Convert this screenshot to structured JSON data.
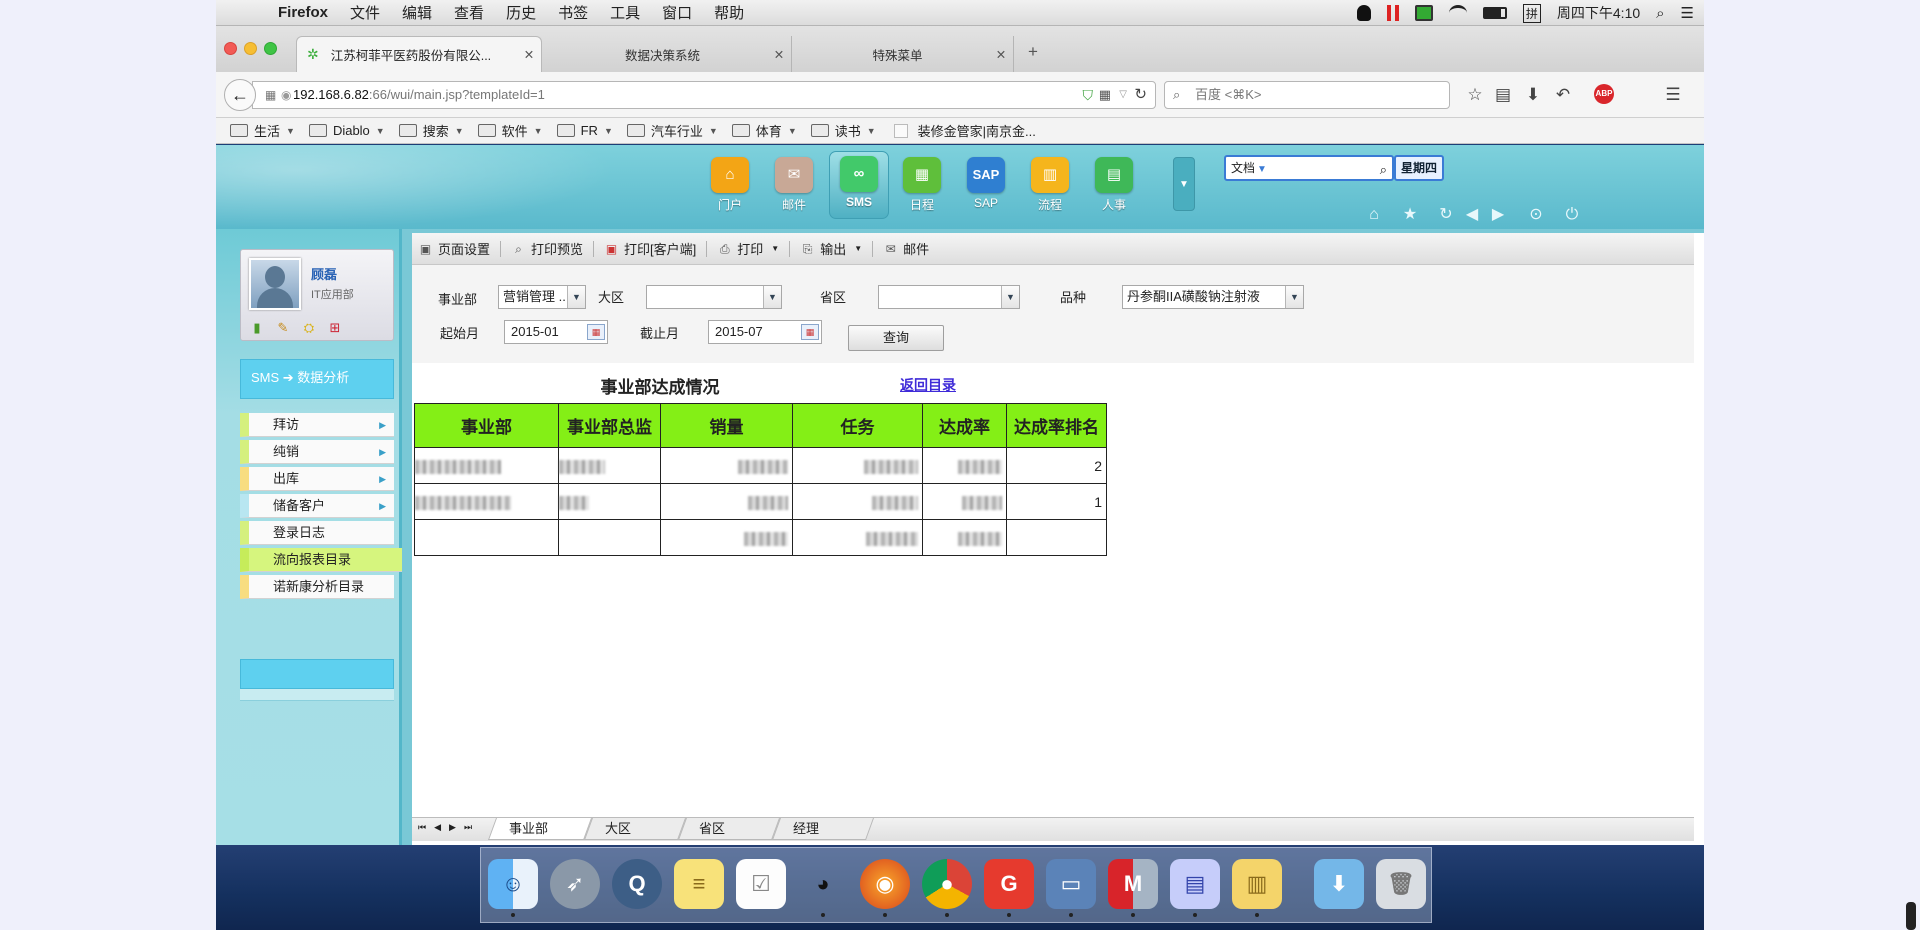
{
  "menubar": {
    "app_name": "Firefox",
    "items": [
      "文件",
      "编辑",
      "查看",
      "历史",
      "书签",
      "工具",
      "窗口",
      "帮助"
    ],
    "clock": "周四下午4:10",
    "ime_label": "拼"
  },
  "tabs": [
    {
      "label": "江苏柯菲平医药股份有限公...",
      "active": true
    },
    {
      "label": "数据决策系统",
      "active": false
    },
    {
      "label": "特殊菜单",
      "active": false
    }
  ],
  "navbar": {
    "url_host": "192.168.6.82",
    "url_path": ":66/wui/main.jsp?templateId=1",
    "search_placeholder": "百度 <⌘K>"
  },
  "bookmarks": [
    {
      "label": "生活",
      "dropdown": true
    },
    {
      "label": "Diablo",
      "dropdown": true
    },
    {
      "label": "搜索",
      "dropdown": true
    },
    {
      "label": "软件",
      "dropdown": true
    },
    {
      "label": "FR",
      "dropdown": true
    },
    {
      "label": "汽车行业",
      "dropdown": true
    },
    {
      "label": "体育",
      "dropdown": true
    },
    {
      "label": "读书",
      "dropdown": true
    },
    {
      "label": "装修金管家|南京金...",
      "dropdown": false
    }
  ],
  "apps": [
    {
      "label": "门户",
      "icon": "home-icon",
      "color": "#f3a515"
    },
    {
      "label": "邮件",
      "icon": "mail-icon",
      "color": "#c8a896"
    },
    {
      "label": "SMS",
      "icon": "infinity-icon",
      "color": "#42c96a",
      "active": true
    },
    {
      "label": "日程",
      "icon": "calendar-icon",
      "color": "#5fbf3b"
    },
    {
      "label": "SAP",
      "icon": "sap-icon",
      "color": "#2f7fd1"
    },
    {
      "label": "流程",
      "icon": "chart-icon",
      "color": "#f5b51c"
    },
    {
      "label": "人事",
      "icon": "people-icon",
      "color": "#3fb858"
    }
  ],
  "doc_search": {
    "category": "文档",
    "weekday": "星期四"
  },
  "user": {
    "name": "顾磊",
    "dept": "IT应用部"
  },
  "sidebar": {
    "title": "SMS ➔ 数据分析",
    "items": [
      {
        "label": "拜访",
        "arrow": true,
        "style": "green"
      },
      {
        "label": "纯销",
        "arrow": true,
        "style": "green"
      },
      {
        "label": "出库",
        "arrow": true,
        "style": "yellow"
      },
      {
        "label": "储备客户",
        "arrow": true,
        "style": "blue"
      },
      {
        "label": "登录日志",
        "arrow": false,
        "style": "green"
      },
      {
        "label": "流向报表目录",
        "arrow": false,
        "style": "selected"
      },
      {
        "label": "诺新康分析目录",
        "arrow": false,
        "style": "yellow"
      }
    ]
  },
  "toolbar": {
    "page_setup": "页面设置",
    "print_preview": "打印预览",
    "print_client": "打印[客户端]",
    "print": "打印",
    "export": "输出",
    "email": "邮件"
  },
  "filters": {
    "division_label": "事业部",
    "division_value": "营销管理 ...",
    "region_label": "大区",
    "region_value": "",
    "province_label": "省区",
    "province_value": "",
    "product_label": "品种",
    "product_value": "丹参酮IIA磺酸钠注射液",
    "start_label": "起始月",
    "start_value": "2015-01",
    "end_label": "截止月",
    "end_value": "2015-07",
    "query_button": "查询"
  },
  "report": {
    "title": "事业部达成情况",
    "back_link": "返回目录",
    "columns": [
      "事业部",
      "事业部总监",
      "销量",
      "任务",
      "达成率",
      "达成率排名"
    ],
    "rows": [
      {
        "rank": "2"
      },
      {
        "rank": "1"
      },
      {
        "rank": ""
      }
    ]
  },
  "sheet_tabs": [
    "事业部",
    "大区",
    "省区",
    "经理"
  ],
  "dock": [
    "finder-icon",
    "launchpad-icon",
    "quicktime-icon",
    "notes-icon",
    "reminders-icon",
    "qq-icon",
    "firefox-icon",
    "chrome-icon",
    "app-g-icon",
    "monitor-icon",
    "app-m-icon",
    "screen-icon",
    "folder-icon",
    "downloads-icon",
    "trash-icon"
  ]
}
